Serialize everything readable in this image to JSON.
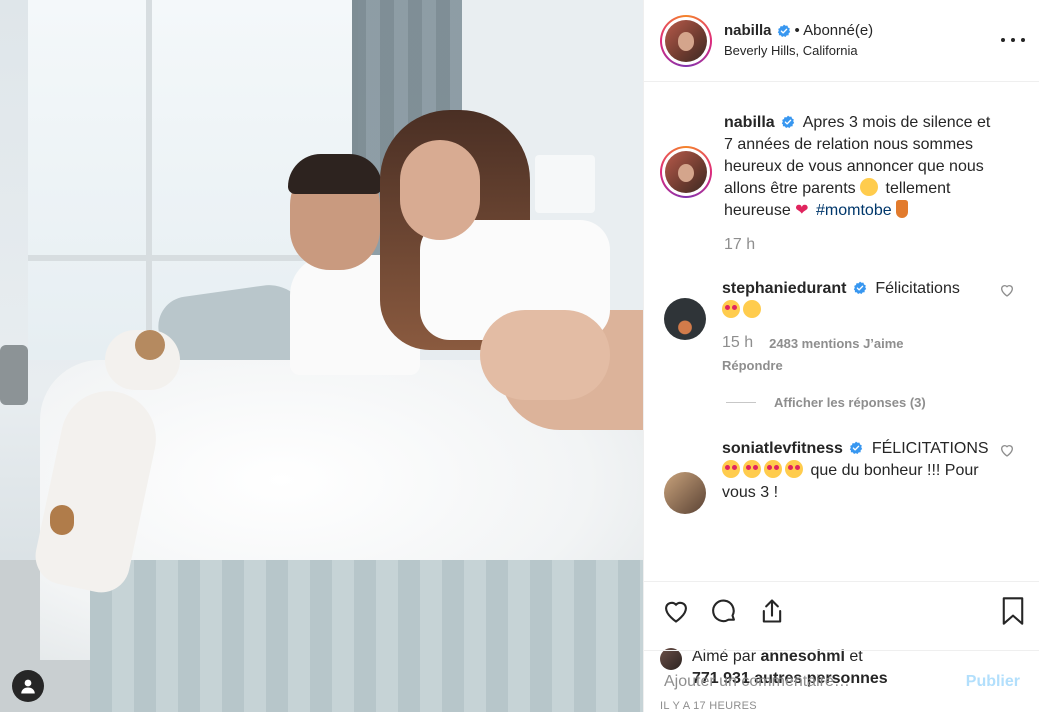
{
  "post": {
    "author": {
      "username": "nabilla",
      "follow_status": "• Abonné(e)",
      "location": "Beverly Hills, California"
    },
    "caption": {
      "username": "nabilla",
      "text_part1": "Apres 3 mois de silence et 7 années de relation nous sommes heureux de vous annoncer que nous allons être parents",
      "text_part2": "tellement heureuse",
      "hashtag": "#momtobe",
      "time": "17 h"
    },
    "comments": [
      {
        "username": "stephaniedurant",
        "text": "Félicitations",
        "time": "15 h",
        "likes": "2483 mentions J’aime",
        "reply_label": "Répondre",
        "view_replies": "Afficher les réponses (3)"
      },
      {
        "username": "soniatlevfitness",
        "text_part1": "FÉLICITATIONS",
        "text_part2": "que du bonheur !!! Pour vous 3 !"
      }
    ],
    "likes": {
      "prefix": "Aimé par",
      "first_user": "annesohml",
      "connector": "et",
      "others": "771 931 autres personnes"
    },
    "timestamp": "IL Y A 17 HEURES",
    "add_comment": {
      "placeholder": "Ajouter un commentaire…",
      "publish_label": "Publier"
    }
  },
  "icons": {
    "verified": "verified-badge-icon",
    "more": "more-options-icon",
    "like": "heart-icon",
    "comment": "comment-bubble-icon",
    "share": "share-icon",
    "save": "bookmark-icon",
    "user": "user-icon"
  },
  "colors": {
    "verified_blue": "#3897f0",
    "hashtag": "#00376b",
    "muted": "#8e8e8e",
    "publish_disabled": "#b2dffc",
    "text": "#262626"
  }
}
